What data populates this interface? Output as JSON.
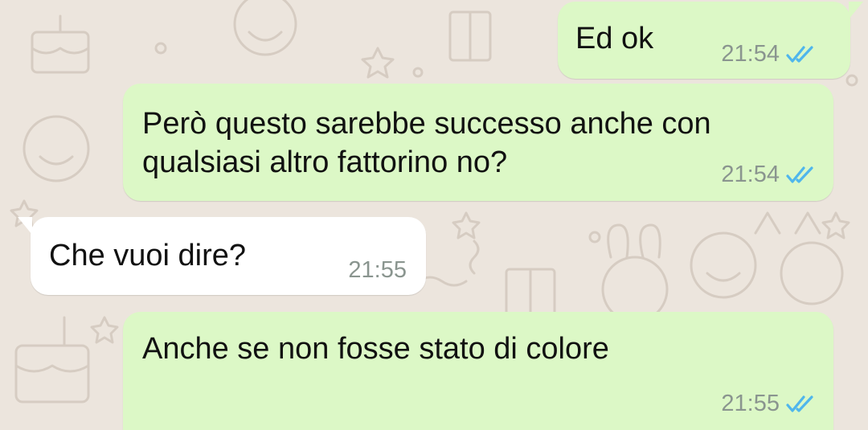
{
  "chat": {
    "messages": [
      {
        "direction": "outgoing",
        "text": "Ed ok",
        "time": "21:54",
        "status_icon": "double-check-read-icon"
      },
      {
        "direction": "outgoing",
        "text": "Però questo sarebbe successo anche con\nqualsiasi altro fattorino no?",
        "time": "21:54",
        "status_icon": "double-check-read-icon"
      },
      {
        "direction": "incoming",
        "text": "Che vuoi dire?",
        "time": "21:55"
      },
      {
        "direction": "outgoing",
        "text": "Anche se non fosse stato di colore",
        "time": "21:55",
        "status_icon": "double-check-read-icon"
      }
    ]
  },
  "colors": {
    "wallpaper": "#ece5dd",
    "outgoing_bubble": "#dcf8c6",
    "incoming_bubble": "#ffffff",
    "read_ticks": "#4fb6ec",
    "timestamp": "#8a958f"
  }
}
